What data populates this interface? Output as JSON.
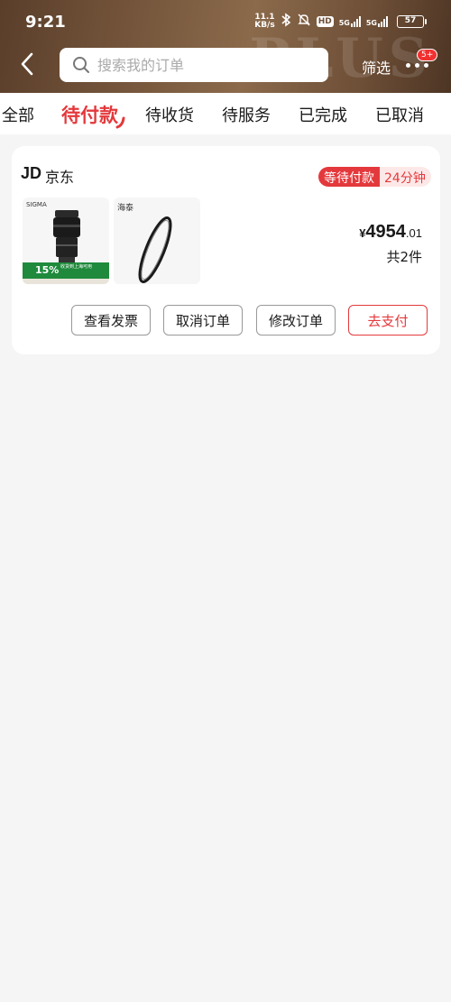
{
  "status_bar": {
    "time": "9:21",
    "net_speed_value": "11.1",
    "net_speed_unit": "KB/s",
    "hd_label": "HD",
    "sim1_label": "5G",
    "sim2_label": "5G",
    "battery": "57",
    "icons": [
      "bluetooth-icon",
      "mute-icon",
      "hd-voice-icon",
      "signal-icon",
      "battery-icon"
    ]
  },
  "header": {
    "back_icon": "chevron-left-icon",
    "search_placeholder": "搜索我的订单",
    "filter_label": "筛选",
    "more_badge": "5+"
  },
  "tabs": [
    {
      "label": "全部",
      "active": false
    },
    {
      "label": "待付款",
      "active": true
    },
    {
      "label": "待收货",
      "active": false
    },
    {
      "label": "待服务",
      "active": false
    },
    {
      "label": "已完成",
      "active": false
    },
    {
      "label": "已取消",
      "active": false
    }
  ],
  "order": {
    "shop_logo": "JD",
    "shop_name": "京东",
    "status": "等待付款",
    "countdown": "24分钟",
    "items": [
      {
        "brand": "SIGMA",
        "promo_pct": "15%",
        "promo_text": "收货到上海可用"
      },
      {
        "brand": "海泰"
      }
    ],
    "price_currency": "¥",
    "price_int": "4954",
    "price_dec": ".01",
    "item_count": "共2件",
    "buttons": {
      "invoice": "查看发票",
      "cancel": "取消订单",
      "modify": "修改订单",
      "pay": "去支付"
    }
  },
  "colors": {
    "accent": "#e4393c",
    "header_brown": "#7a5a3f",
    "background": "#f5f5f5"
  }
}
